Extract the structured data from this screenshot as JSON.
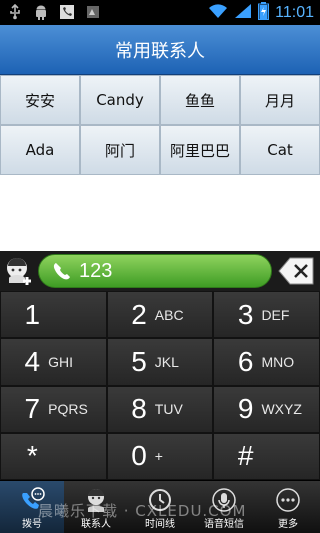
{
  "status": {
    "time": "11:01",
    "icons": [
      "usb-icon",
      "android-debug-icon",
      "missed-call-icon",
      "notification-icon",
      "wifi-icon",
      "signal-icon",
      "battery-charging-icon"
    ]
  },
  "title": "常用联系人",
  "contacts": [
    "安安",
    "Candy",
    "鱼鱼",
    "月月",
    "Ada",
    "阿门",
    "阿里巴巴",
    "Cat"
  ],
  "dialer": {
    "number": "123"
  },
  "keys": [
    {
      "digit": "1",
      "letters": ""
    },
    {
      "digit": "2",
      "letters": "ABC"
    },
    {
      "digit": "3",
      "letters": "DEF"
    },
    {
      "digit": "4",
      "letters": "GHI"
    },
    {
      "digit": "5",
      "letters": "JKL"
    },
    {
      "digit": "6",
      "letters": "MNO"
    },
    {
      "digit": "7",
      "letters": "PQRS"
    },
    {
      "digit": "8",
      "letters": "TUV"
    },
    {
      "digit": "9",
      "letters": "WXYZ"
    },
    {
      "digit": "*",
      "letters": ""
    },
    {
      "digit": "0",
      "letters": "+"
    },
    {
      "digit": "#",
      "letters": ""
    }
  ],
  "tabs": [
    {
      "label": "拨号",
      "icon": "dialpad-icon",
      "active": true
    },
    {
      "label": "联系人",
      "icon": "contacts-icon",
      "active": false
    },
    {
      "label": "时间线",
      "icon": "clock-icon",
      "active": false
    },
    {
      "label": "语音短信",
      "icon": "microphone-icon",
      "active": false
    },
    {
      "label": "更多",
      "icon": "more-icon",
      "active": false
    }
  ],
  "watermark": "晨曦乐下载 · CXLEDU.COM",
  "colors": {
    "accent": "#2a6fbf",
    "call_green": "#4caf2f"
  }
}
